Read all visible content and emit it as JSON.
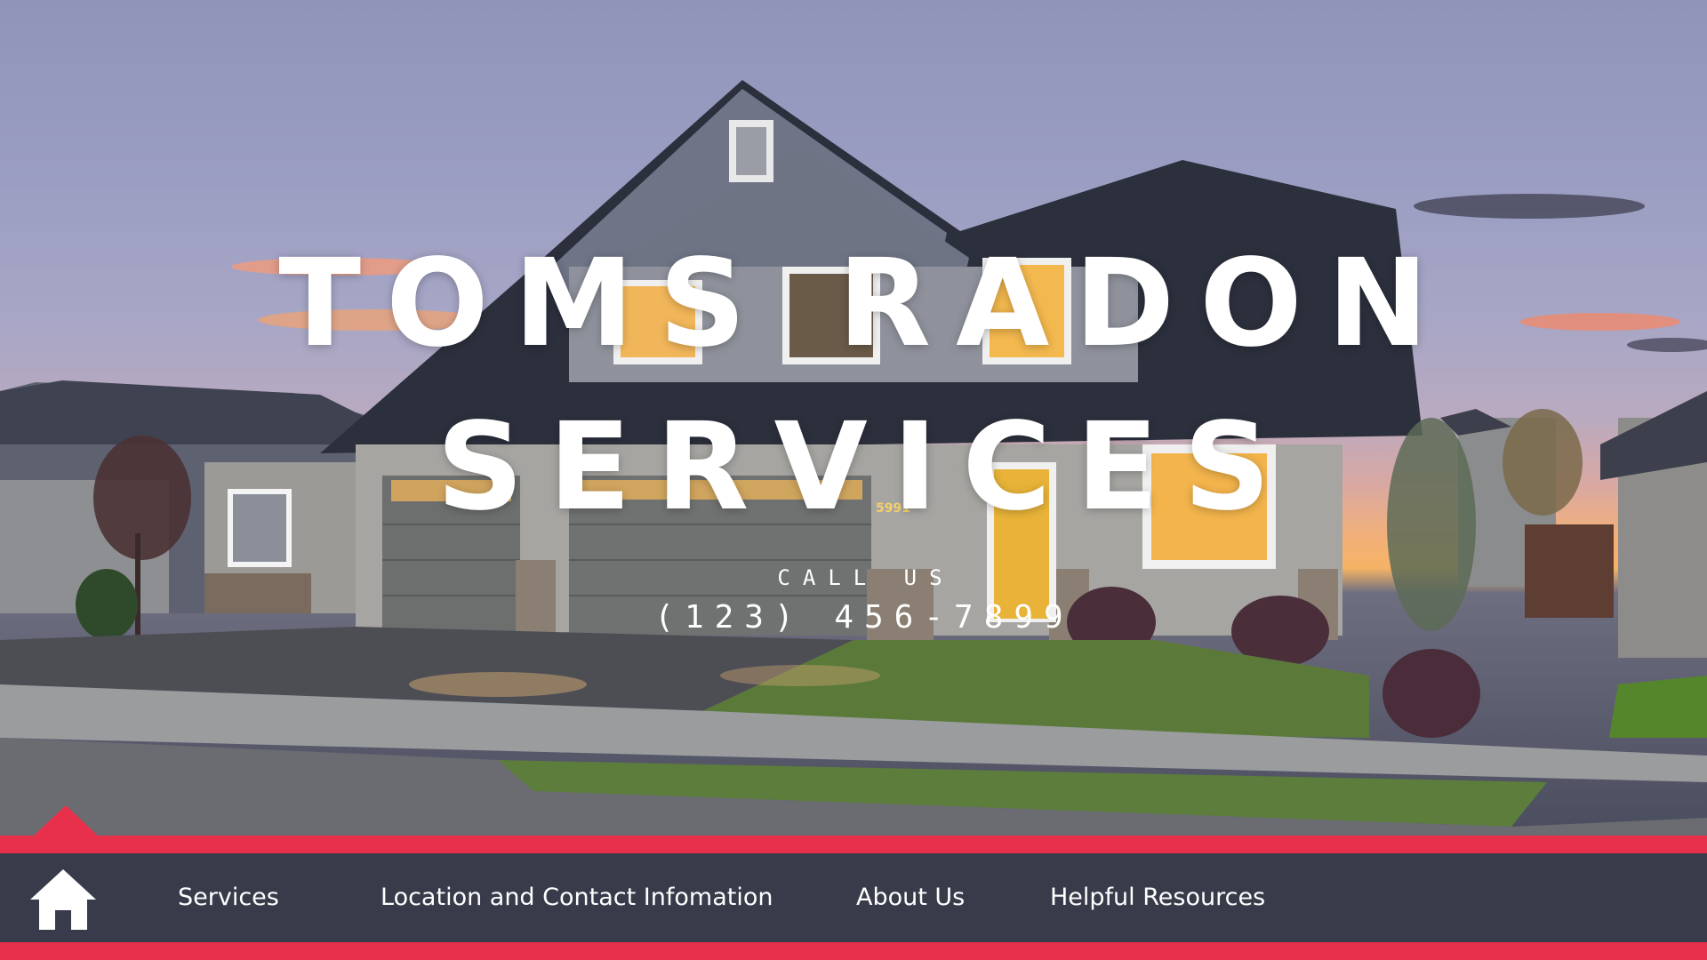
{
  "hero": {
    "title_line1": "TOMS RADON",
    "title_line2": "SERVICES",
    "call_label": "CALL US",
    "phone": "(123) 456-7899",
    "house_number": "5991"
  },
  "nav": {
    "items": [
      {
        "label": "Services"
      },
      {
        "label": "Location and Contact Infomation"
      },
      {
        "label": "About Us"
      },
      {
        "label": "Helpful Resources"
      }
    ]
  },
  "colors": {
    "accent": "#e8304a",
    "nav_background": "#373b4a",
    "text": "#ffffff"
  },
  "icons": {
    "home": "home-icon"
  }
}
